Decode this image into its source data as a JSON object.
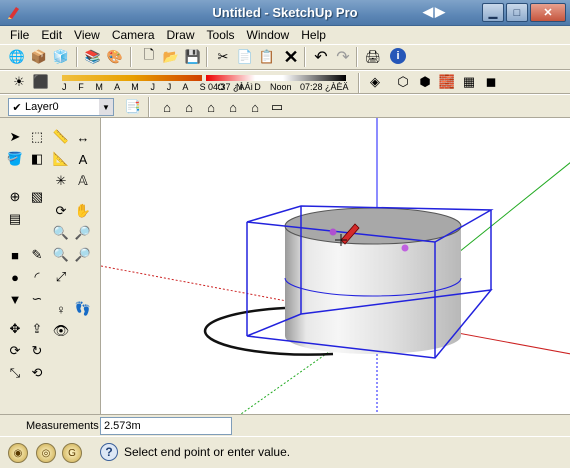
{
  "window": {
    "title": "Untitled - SketchUp Pro"
  },
  "menu": [
    "File",
    "Edit",
    "View",
    "Camera",
    "Draw",
    "Tools",
    "Window",
    "Help"
  ],
  "shadow": {
    "months": "J F M A M J J A S O N D",
    "time_start": "04:37 ¿ÀÁì",
    "noon": "Noon",
    "time_end": "07:28 ¿ÀÈÄ"
  },
  "layer": {
    "name": "Layer0"
  },
  "measurements": {
    "label": "Measurements",
    "value": "2.573m"
  },
  "status": {
    "text": "Select end point or enter value."
  },
  "colors": {
    "axis_red": "#cc2222",
    "axis_green": "#22aa22",
    "axis_blue": "#1a1aff",
    "bbox": "#2222dd"
  }
}
